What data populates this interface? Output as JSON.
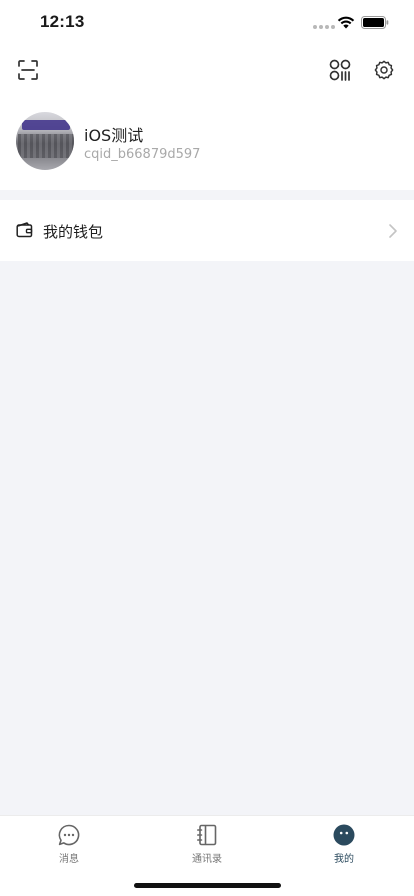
{
  "status_bar": {
    "time": "12:13"
  },
  "header": {
    "scan_icon": "scan-icon",
    "qrcode_icon": "qrcode-icon",
    "settings_icon": "gear-icon"
  },
  "profile": {
    "name": "iOS测试",
    "id": "cqid_b66879d597"
  },
  "menu": {
    "wallet_label": "我的钱包"
  },
  "tab_bar": {
    "tabs": [
      {
        "label": "消息",
        "icon": "chat-bubble-icon",
        "active": false
      },
      {
        "label": "通讯录",
        "icon": "address-book-icon",
        "active": false
      },
      {
        "label": "我的",
        "icon": "profile-face-icon",
        "active": true
      }
    ]
  },
  "colors": {
    "page_background": "#f3f4f8",
    "active_tab": "#2b4a5e",
    "inactive_tab": "#777777"
  }
}
